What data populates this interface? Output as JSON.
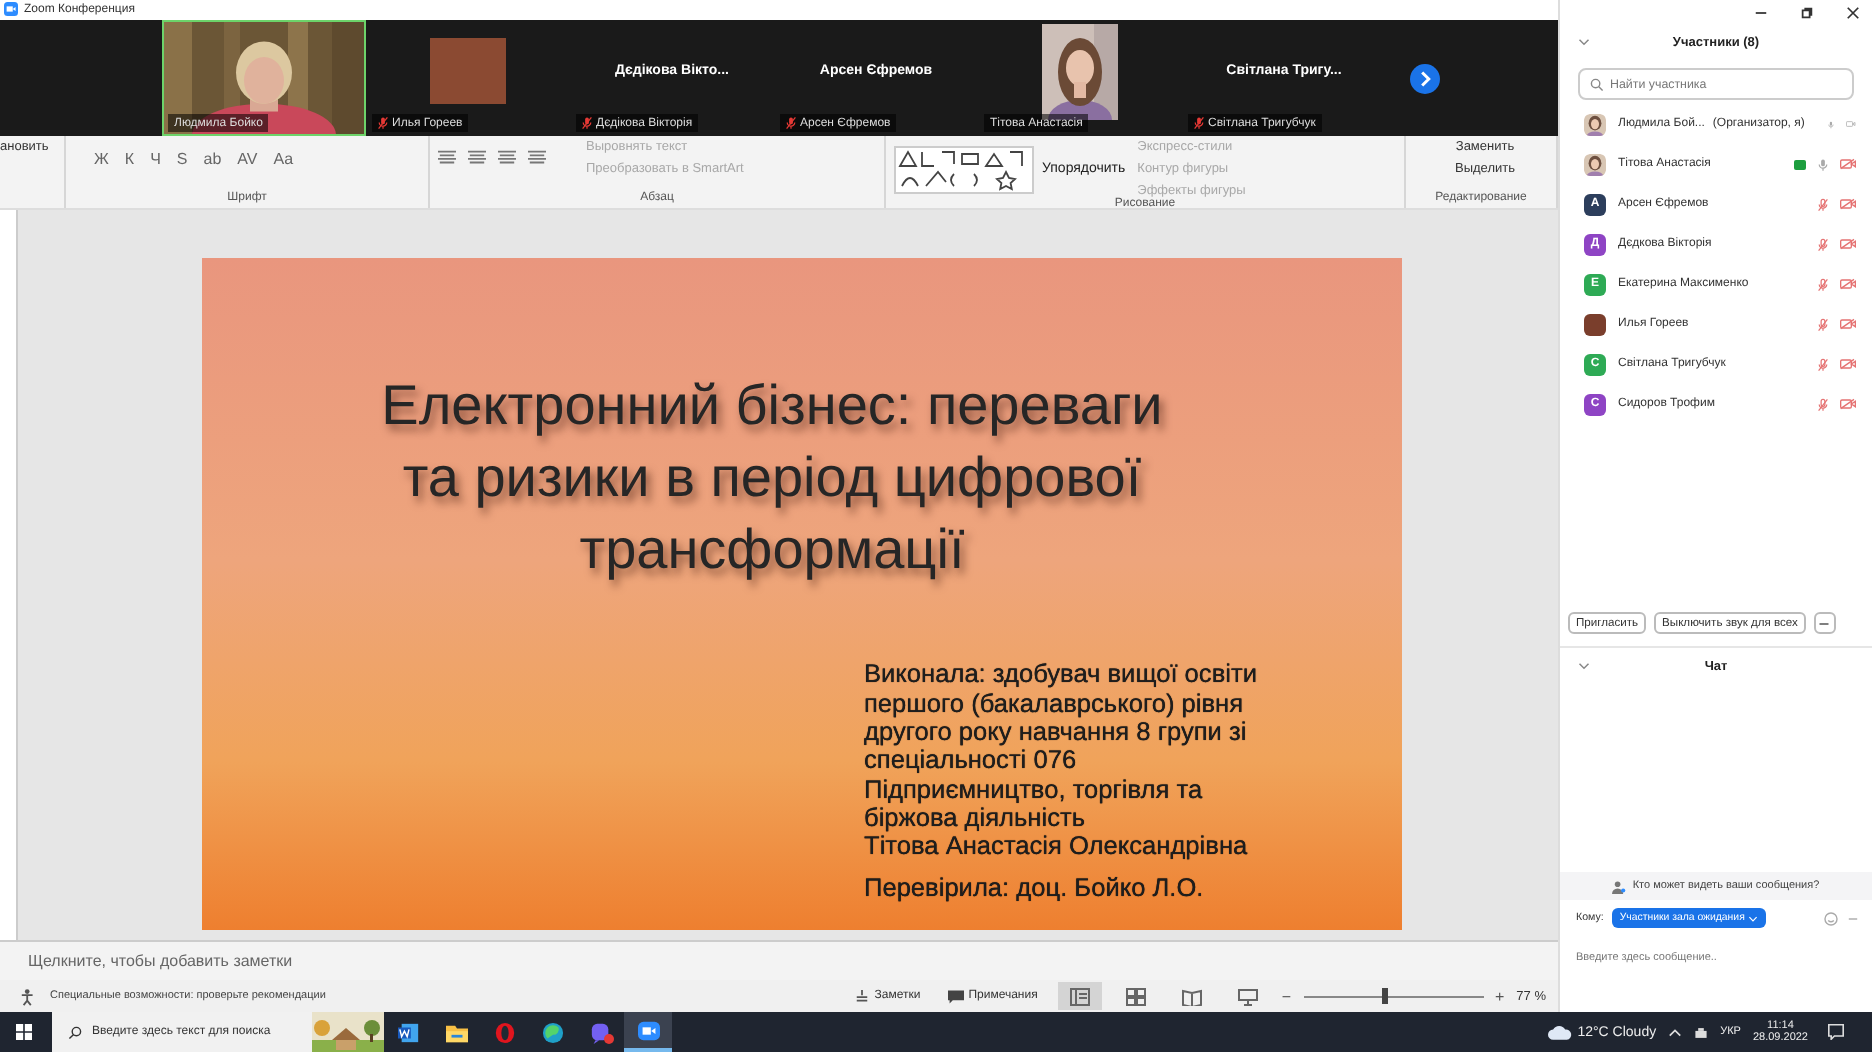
{
  "window": {
    "title": "Zoom Конференция"
  },
  "video_strip": {
    "tiles": [
      {
        "kind": "camera",
        "name": "Людмила Бойко",
        "muted": false,
        "speaking": true
      },
      {
        "kind": "color",
        "name": "Илья Гореев",
        "color": "#8b4a32",
        "muted": true,
        "speaking": false
      },
      {
        "kind": "name",
        "heading": "Дєдікова Вікто...",
        "name": "Дєдікова Вікторія",
        "muted": true,
        "speaking": false
      },
      {
        "kind": "name",
        "heading": "Арсен Єфремов",
        "name": "Арсен Єфремов",
        "muted": true,
        "speaking": false
      },
      {
        "name": "Тітова Анастасія",
        "muted": false,
        "speaking": false
      },
      {
        "kind": "name",
        "heading": "Світлана Тригу...",
        "name": "Світлана Тригубчук",
        "muted": true,
        "speaking": false
      }
    ]
  },
  "ribbon": {
    "cut_label": "ановить",
    "font": {
      "label": "Шрифт",
      "buttons": [
        "Ж",
        "К",
        "Ч",
        "S",
        "ab",
        "AV",
        "Aa"
      ]
    },
    "paragraph": {
      "label": "Абзац",
      "commands": [
        {
          "label": "Выровнять текст",
          "disabled": true
        },
        {
          "label": "Преобразовать в SmartArt",
          "disabled": true
        }
      ]
    },
    "drawing": {
      "label": "Рисование",
      "arrange": "Упорядочить",
      "commands": [
        {
          "label": "Экспресс-стили",
          "disabled": true
        },
        {
          "label": "Контур фигуры",
          "disabled": true
        },
        {
          "label": "Эффекты фигуры",
          "disabled": true
        }
      ]
    },
    "editing": {
      "label": "Редактирование",
      "commands": [
        {
          "label": "Заменить",
          "disabled": false
        },
        {
          "label": "Выделить",
          "disabled": false
        }
      ]
    }
  },
  "slide": {
    "title_lines": [
      "Електронний бізнес: переваги",
      "та ризики в період цифрової",
      "трансформації"
    ],
    "body_lines": [
      "Виконала: здобувач вищої освіти",
      "першого (бакалаврського) рівня",
      "другого року навчання 8 групи зі",
      "спеціальності 076",
      "Підприємництво, торгівля та",
      "біржова діяльність",
      "Тітова Анастасія Олександрівна"
    ],
    "reviewer": "Перевірила: доц. Бойко Л.О."
  },
  "notes": {
    "placeholder": "Щелкните, чтобы добавить заметки"
  },
  "status_bar": {
    "accessibility": "Специальные возможности: проверьте рекомендации",
    "notes_button": "Заметки",
    "comments_button": "Примечания",
    "views": [
      {
        "kind": "normal",
        "selected": true
      },
      {
        "kind": "sorter",
        "selected": false
      },
      {
        "kind": "reading",
        "selected": false
      },
      {
        "kind": "show",
        "selected": false
      }
    ],
    "zoom_out": "−",
    "zoom_in": "+",
    "zoom": {
      "level": 0.45
    },
    "zoom_value": "77 %"
  },
  "participants": {
    "title": "Участники (8)",
    "search": {
      "placeholder": "Найти участника"
    },
    "items": [
      {
        "name": "Людмила Бой...",
        "role": "(Организатор, я)",
        "muted": false,
        "camera_off": false,
        "green_tag": false
      },
      {
        "name": "Тітова Анастасія",
        "muted": false,
        "camera_off": true,
        "green_tag": true
      },
      {
        "name": "Арсен Єфремов",
        "avatar": {
          "kind": "letter",
          "letter": "А",
          "color": "#2c3e5c"
        },
        "muted": true,
        "camera_off": true,
        "green_tag": false
      },
      {
        "name": "Дєдкова Вікторія",
        "avatar": {
          "kind": "letter",
          "letter": "Д",
          "color": "#8e44c4"
        },
        "muted": true,
        "camera_off": true,
        "green_tag": false
      },
      {
        "name": "Екатерина Максименко",
        "avatar": {
          "kind": "letter",
          "letter": "Е",
          "color": "#2eaa55"
        },
        "muted": true,
        "camera_off": true,
        "green_tag": false
      },
      {
        "name": "Илья Гореев",
        "avatar": {
          "kind": "color",
          "color": "#7a3e2c"
        },
        "muted": true,
        "camera_off": true,
        "green_tag": false
      },
      {
        "name": "Світлана Тригубчук",
        "avatar": {
          "kind": "letter",
          "letter": "С",
          "color": "#2eaa55"
        },
        "muted": true,
        "camera_off": true,
        "green_tag": false
      },
      {
        "name": "Сидоров Трофим",
        "avatar": {
          "kind": "letter",
          "letter": "С",
          "color": "#8e44c4"
        },
        "muted": true,
        "camera_off": true,
        "green_tag": false
      }
    ],
    "buttons": [
      "Пригласить",
      "Выключить звук для всех"
    ]
  },
  "chat": {
    "title": "Чат",
    "privacy": "Кто может видеть ваши сообщения?",
    "to_label": "Кому:",
    "recipient": "Участники зала ожидания",
    "input": {
      "placeholder": "Введите здесь сообщение.."
    }
  },
  "taskbar": {
    "search": {
      "placeholder": "Введите здесь текст для поиска"
    },
    "apps": [
      {
        "kind": "word",
        "active": false,
        "badge": false
      },
      {
        "kind": "folder",
        "active": false,
        "badge": false
      },
      {
        "kind": "opera",
        "active": false,
        "badge": false
      },
      {
        "kind": "edge",
        "active": false,
        "badge": false
      },
      {
        "kind": "viber",
        "active": false,
        "badge": true
      },
      {
        "kind": "zoom",
        "active": true,
        "badge": false
      }
    ],
    "weather": "12°C Cloudy",
    "language": "УКР",
    "time": "11:14",
    "date": "28.09.2022"
  }
}
